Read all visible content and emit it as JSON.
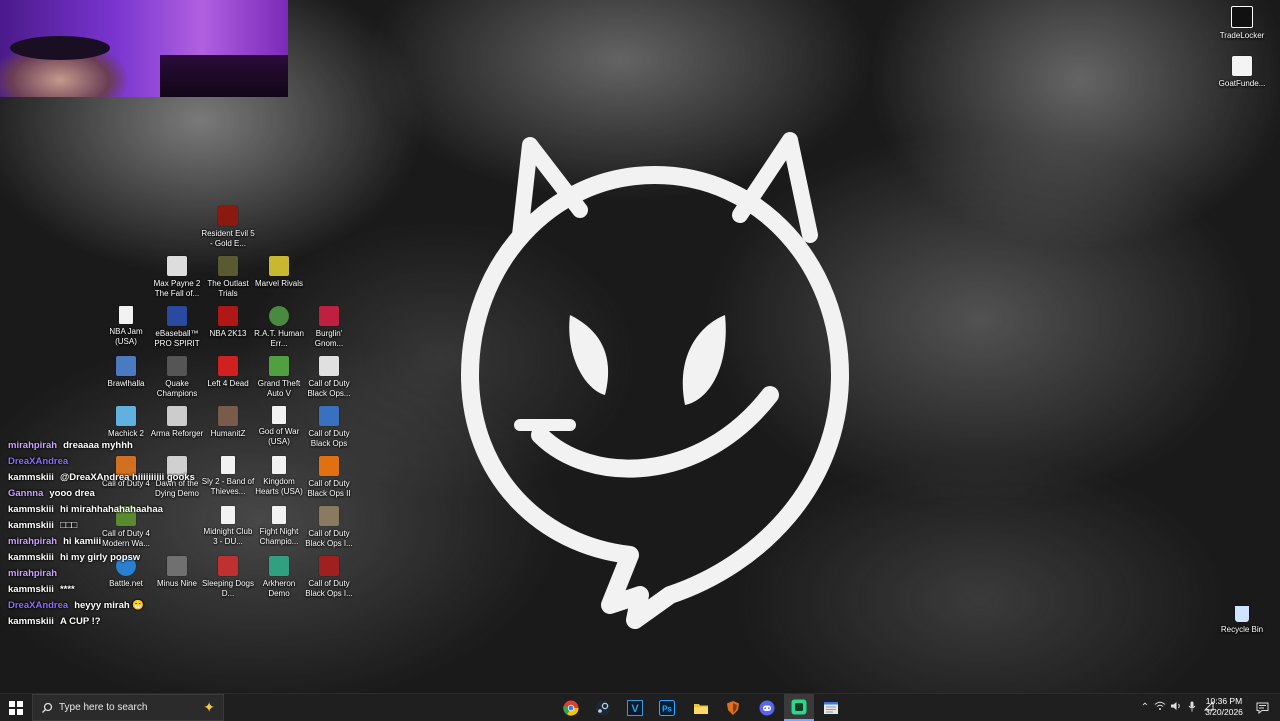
{
  "webcam": {
    "label": ""
  },
  "desktop_icons_right": [
    {
      "id": "tradelocker",
      "label": "TradeLocker",
      "color": "#ffffff"
    },
    {
      "id": "goatfunded",
      "label": "GoatFunde...",
      "color": "#ffffff"
    },
    {
      "id": "recyclebin",
      "label": "Recycle Bin",
      "color": "#d0e4ff"
    }
  ],
  "desktop_icons": [
    {
      "label": "Resident Evil 5 - Gold E...",
      "color": "#8a1a10"
    },
    {
      "label": "Max Payne 2 The Fall of...",
      "color": "#dddddd"
    },
    {
      "label": "The Outlast Trials",
      "color": "#5a5a30"
    },
    {
      "label": "Marvel Rivals",
      "color": "#c8b830"
    },
    {
      "label": "NBA Jam (USA)",
      "color": "#f2f2f2"
    },
    {
      "label": "eBaseball™ PRO SPIRIT",
      "color": "#2a4aa0"
    },
    {
      "label": "NBA 2K13",
      "color": "#b01818"
    },
    {
      "label": "R.A.T. Human Err...",
      "color": "#4a8a40"
    },
    {
      "label": "Burglin' Gnom...",
      "color": "#c02040"
    },
    {
      "label": "Brawlhalla",
      "color": "#4a7ac0"
    },
    {
      "label": "Quake Champions",
      "color": "#555555"
    },
    {
      "label": "Left 4 Dead",
      "color": "#d02020"
    },
    {
      "label": "Grand Theft Auto V",
      "color": "#50a040"
    },
    {
      "label": "Call of Duty Black Ops...",
      "color": "#e0e0e0"
    },
    {
      "label": "Machick 2",
      "color": "#60b0e0"
    },
    {
      "label": "Arma Reforger",
      "color": "#cccccc"
    },
    {
      "label": "HumanitZ",
      "color": "#7a5a4a"
    },
    {
      "label": "God of War (USA)",
      "color": "#f2f2f2"
    },
    {
      "label": "Call of Duty Black Ops",
      "color": "#3a70c0"
    },
    {
      "label": "Call of Duty 4",
      "color": "#d07020"
    },
    {
      "label": "Dawn of the Dying Demo",
      "color": "#d0d0d0"
    },
    {
      "label": "Sly 2 - Band of Thieves...",
      "color": "#f2f2f2"
    },
    {
      "label": "Kingdom Hearts (USA)",
      "color": "#f2f2f2"
    },
    {
      "label": "Call of Duty Black Ops II",
      "color": "#e07010"
    },
    {
      "label": "Call of Duty 4 Modern Wa...",
      "color": "#5a8a30"
    },
    {
      "label": "Midnight Club 3 - DU...",
      "color": "#f2f2f2"
    },
    {
      "label": "Fight Night Champio...",
      "color": "#f2f2f2"
    },
    {
      "label": "Call of Duty Black Ops I...",
      "color": "#8a7a60"
    },
    {
      "label": "Battle.net",
      "color": "#2a80d0"
    },
    {
      "label": "Minus Nine",
      "color": "#707070"
    },
    {
      "label": "Sleeping Dogs D...",
      "color": "#c03030"
    },
    {
      "label": "Arkheron Demo",
      "color": "#30a080"
    },
    {
      "label": "Call of Duty Black Ops I...",
      "color": "#a02020"
    }
  ],
  "chat": [
    {
      "user": "mirahpirah",
      "text": "dreaaaa myhhh",
      "color": "#c9a3ff"
    },
    {
      "user": "DreaXAndrea",
      "text": "",
      "color": "#8a6cff"
    },
    {
      "user": "kammskiii",
      "text": "@DreaXAndrea hiiiiiiiiii gooks",
      "color": "#ffffff"
    },
    {
      "user": "Gannna",
      "text": "yooo drea",
      "color": "#c9a3ff"
    },
    {
      "user": "kammskiii",
      "text": "hi mirahhahahahaahaa",
      "color": "#ffffff"
    },
    {
      "user": "kammskiii",
      "text": "□□□",
      "color": "#ffffff"
    },
    {
      "user": "mirahpirah",
      "text": "hi kamiii",
      "color": "#c9a3ff"
    },
    {
      "user": "kammskiii",
      "text": "hi my girly popsw",
      "color": "#ffffff"
    },
    {
      "user": "mirahpirah",
      "text": "",
      "color": "#c9a3ff"
    },
    {
      "user": "kammskiii",
      "text": "****",
      "color": "#ffffff"
    },
    {
      "user": "DreaXAndrea",
      "text": "heyyy mirah 😁",
      "color": "#8a6cff"
    },
    {
      "user": "kammskiii",
      "text": "A CUP !?",
      "color": "#ffffff"
    }
  ],
  "taskbar": {
    "search_placeholder": "Type here to search",
    "apps": [
      {
        "name": "chrome-icon",
        "color": "#e0402a"
      },
      {
        "name": "steam-icon",
        "color": "#4aa0d8"
      },
      {
        "name": "v-app-icon",
        "color": "#3a9ad8"
      },
      {
        "name": "photoshop-icon",
        "color": "#2b6bd8"
      },
      {
        "name": "file-explorer-icon",
        "color": "#f0c040"
      },
      {
        "name": "shield-app-icon",
        "color": "#e07020"
      },
      {
        "name": "discord-icon",
        "color": "#5865f2"
      },
      {
        "name": "streaming-app-icon",
        "color": "#2ad88a"
      },
      {
        "name": "notepad-icon",
        "color": "#e8e8e8"
      }
    ],
    "time": "10:36 PM",
    "date": "3/20/2026"
  }
}
